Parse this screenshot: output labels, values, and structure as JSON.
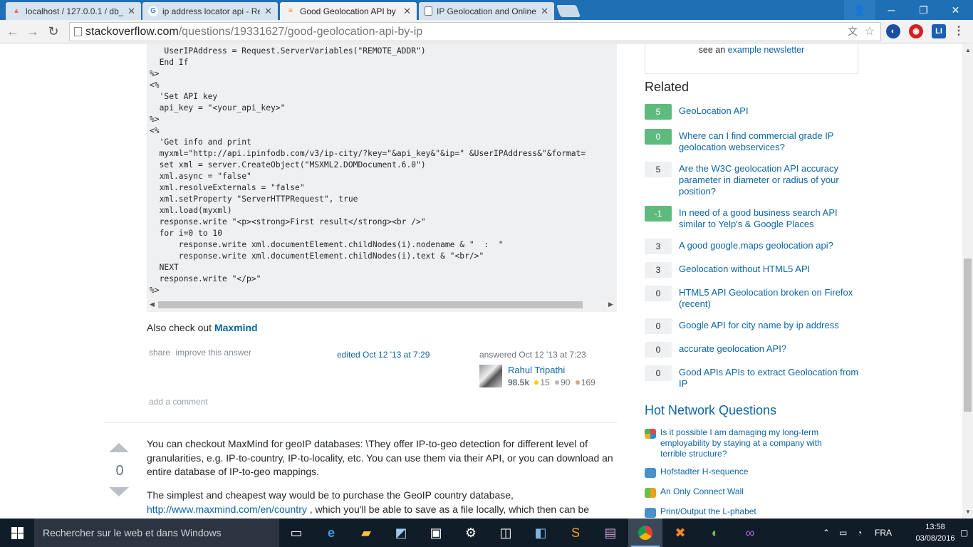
{
  "browser": {
    "tabs": [
      {
        "label": "localhost / 127.0.0.1 / db_",
        "favicon": "phpmyadmin-icon",
        "active": false
      },
      {
        "label": "ip address locator api - Re",
        "favicon": "google-icon",
        "active": false
      },
      {
        "label": "Good Geolocation API by",
        "favicon": "stackoverflow-icon",
        "active": true
      },
      {
        "label": "IP Geolocation and Online",
        "favicon": "page-icon",
        "active": false
      }
    ],
    "url_host": "stackoverflow.com",
    "url_path": "/questions/19331627/good-geolocation-api-by-ip"
  },
  "answer1": {
    "code_lines": [
      "   UserIPAddress = Request.ServerVariables(\"REMOTE_ADDR\")",
      "  End If",
      "%>",
      "<%",
      "  'Set API key",
      "  api_key = \"<your_api_key>\"",
      "%>",
      "<%",
      "  'Get info and print",
      "  myxml=\"http://api.ipinfodb.com/v3/ip-city/?key=\"&api_key&\"&ip=\" &UserIPAddress&\"&format=",
      "  set xml = server.CreateObject(\"MSXML2.DOMDocument.6.0\")",
      "  xml.async = \"false\"",
      "  xml.resolveExternals = \"false\"",
      "  xml.setProperty \"ServerHTTPRequest\", true",
      "  xml.load(myxml)",
      "  response.write \"<p><strong>First result</strong><br />\"",
      "  for i=0 to 10",
      "      response.write xml.documentElement.childNodes(i).nodename & \"  :  \"",
      "      response.write xml.documentElement.childNodes(i).text & \"<br/>\"",
      "  NEXT",
      "  response.write \"</p>\"",
      "%>"
    ],
    "also_check_prefix": "Also check out ",
    "also_check_link": "Maxmind",
    "share": "share",
    "improve": "improve this answer",
    "edited": "edited Oct 12 '13 at 7:29",
    "answered": "answered Oct 12 '13 at 7:23",
    "user_name": "Rahul Tripathi",
    "reputation": "98.5k",
    "gold": "15",
    "silver": "90",
    "bronze": "169",
    "add_comment": "add a comment"
  },
  "answer2": {
    "votes": "0",
    "p1": "You can checkout MaxMind for geoIP databases: \\They offer IP-to-geo detection for different level of granularities, e.g. IP-to-country, IP-to-locality, etc. You can use them via their API, or you can download an entire database of IP-to-geo mappings.",
    "p2_prefix": "The simplest and cheapest way would be to purchase the GeoIP country database, ",
    "p2_link": "http://www.maxmind.com/en/country",
    "p2_suffix": " , which you'll be able to save as a file locally, which then can be"
  },
  "sidebar": {
    "newsletter_prefix": "see an ",
    "newsletter_link": "example newsletter",
    "related_title": "Related",
    "related": [
      {
        "score": "5",
        "title": "GeoLocation API",
        "accepted": true
      },
      {
        "score": "0",
        "title": "Where can I find commercial grade IP geolocation webservices?",
        "accepted": true
      },
      {
        "score": "5",
        "title": "Are the W3C geolocation API accuracy parameter in diameter or radius of your position?",
        "accepted": false
      },
      {
        "score": "-1",
        "title": "In need of a good business search API similar to Yelp's & Google Places",
        "accepted": true
      },
      {
        "score": "3",
        "title": "A good google.maps geolocation api?",
        "accepted": false
      },
      {
        "score": "3",
        "title": "Geolocation without HTML5 API",
        "accepted": false
      },
      {
        "score": "0",
        "title": "HTML5 API Geolocation broken on Firefox (recent)",
        "accepted": false
      },
      {
        "score": "0",
        "title": "Google API for city name by ip address",
        "accepted": false
      },
      {
        "score": "0",
        "title": "accurate geolocation API?",
        "accepted": false
      },
      {
        "score": "0",
        "title": "Good APIs APIs to extract Geolocation from IP",
        "accepted": false
      }
    ],
    "hot_title": "Hot Network Questions",
    "hot": [
      {
        "title": "Is it possible I am damaging my long-term employability by staying at a company with terrible structure?",
        "icon": "workplace-icon"
      },
      {
        "title": "Hofstadter H-sequence",
        "icon": "codegolf-icon"
      },
      {
        "title": "An Only Connect Wall",
        "icon": "puzzling-icon"
      },
      {
        "title": "Print/Output the L-phabet",
        "icon": "codegolf-icon"
      }
    ]
  },
  "taskbar": {
    "search_placeholder": "Rechercher sur le web et dans Windows",
    "language": "FRA",
    "time": "13:58",
    "date": "03/08/2016"
  },
  "colors": {
    "titlebar": "#1e6fb3",
    "link": "#0c65a5",
    "accepted_badge": "#5fba7d",
    "taskbar": "#101c28"
  }
}
